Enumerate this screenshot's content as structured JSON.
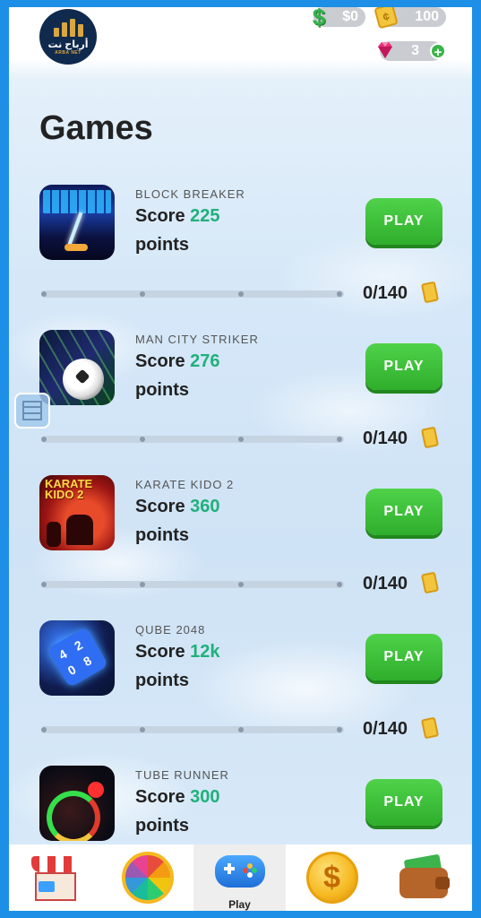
{
  "header": {
    "logo": {
      "arabic": "أرباح نت",
      "english": "ARBA NET"
    },
    "cash": {
      "icon": "dollar-icon",
      "value": "$0"
    },
    "tickets": {
      "icon": "ticket-icon",
      "value": "100"
    },
    "gems": {
      "icon": "gem-icon",
      "value": "3",
      "add_label": "+"
    }
  },
  "page_title": "Games",
  "games": [
    {
      "name": "BLOCK BREAKER",
      "score_label": "Score",
      "score": "225",
      "points_label": "points",
      "play_label": "PLAY",
      "progress": "0/140"
    },
    {
      "name": "MAN CITY STRIKER",
      "score_label": "Score",
      "score": "276",
      "points_label": "points",
      "play_label": "PLAY",
      "progress": "0/140"
    },
    {
      "name": "KARATE KIDO 2",
      "score_label": "Score",
      "score": "360",
      "points_label": "points",
      "play_label": "PLAY",
      "progress": "0/140"
    },
    {
      "name": "QUBE 2048",
      "score_label": "Score",
      "score": "12k",
      "points_label": "points",
      "play_label": "PLAY",
      "progress": "0/140"
    },
    {
      "name": "TUBE RUNNER",
      "score_label": "Score",
      "score": "300",
      "points_label": "points",
      "play_label": "PLAY",
      "progress": ""
    }
  ],
  "thumb_text": {
    "karate": "KARATE KIDO 2",
    "qube": [
      "4",
      "2",
      "0",
      "8"
    ]
  },
  "nav": {
    "items": [
      {
        "id": "shop",
        "icon": "shop-icon",
        "label": ""
      },
      {
        "id": "wheel",
        "icon": "wheel-icon",
        "label": ""
      },
      {
        "id": "play",
        "icon": "gamepad-icon",
        "label": "Play",
        "active": true
      },
      {
        "id": "coins",
        "icon": "coin-icon",
        "label": ""
      },
      {
        "id": "wallet",
        "icon": "wallet-icon",
        "label": ""
      }
    ]
  },
  "colors": {
    "accent": "#2fae2c",
    "score": "#20b07a",
    "frame": "#1e8fe6"
  }
}
